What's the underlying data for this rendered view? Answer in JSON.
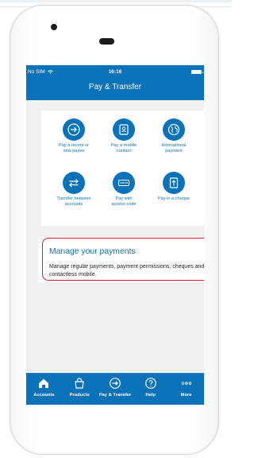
{
  "colors": {
    "brand_blue": "#0a72b8",
    "screen_bg": "#eef0f2",
    "highlight_red": "#d81e2c"
  },
  "status_bar": {
    "carrier": "No SIM",
    "wifi_icon": "wifi-icon",
    "time": "16:16",
    "battery_icon": "battery-icon"
  },
  "header": {
    "title": "Pay & Transfer"
  },
  "actions": [
    {
      "icon": "arrow-circle-right-icon",
      "label_line1": "Pay a recent or",
      "label_line2": "new payee"
    },
    {
      "icon": "contact-card-icon",
      "label_line1": "Pay a mobile",
      "label_line2": "contact"
    },
    {
      "icon": "globe-icon",
      "label_line1": "International",
      "label_line2": "payment"
    },
    {
      "icon": "transfer-arrows-icon",
      "label_line1": "Transfer between",
      "label_line2": "accounts"
    },
    {
      "icon": "access-code-icon",
      "label_line1": "Pay with",
      "label_line2": "access code"
    },
    {
      "icon": "cheque-icon",
      "label_line1": "Pay in a cheque",
      "label_line2": ""
    }
  ],
  "manage": {
    "title": "Manage your payments",
    "description": "Manage regular payments, payment permissions, cheques and contactless mobile.",
    "chevron_icon": "chevron-right-icon"
  },
  "tabbar": {
    "items": [
      {
        "icon": "home-icon",
        "label": "Accounts"
      },
      {
        "icon": "shopping-bag-icon",
        "label": "Products"
      },
      {
        "icon": "pay-transfer-icon",
        "label": "Pay & Transfer"
      },
      {
        "icon": "help-icon",
        "label": "Help"
      },
      {
        "icon": "more-dots-icon",
        "label": "More"
      }
    ]
  }
}
